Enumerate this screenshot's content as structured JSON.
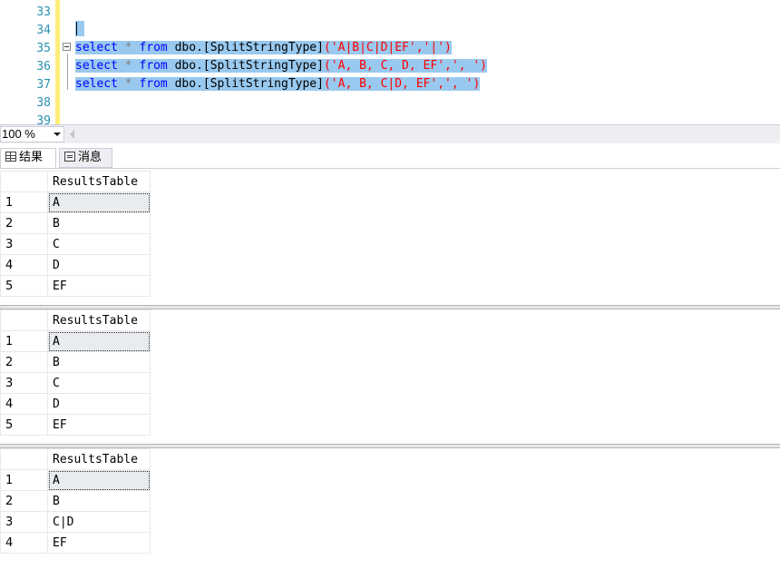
{
  "editor": {
    "line_numbers": [
      "33",
      "34",
      "35",
      "36",
      "37",
      "38",
      "39"
    ],
    "lines": [
      {
        "kw1": "select",
        "star": "*",
        "kw2": "from",
        "obj": "dbo.[SplitStringType]",
        "args": "('A|B|C|D|EF','|')"
      },
      {
        "kw1": "select",
        "star": "*",
        "kw2": "from",
        "obj": "dbo.[SplitStringType]",
        "args": "('A, B, C, D, EF',', ')"
      },
      {
        "kw1": "select",
        "star": "*",
        "kw2": "from",
        "obj": "dbo.[SplitStringType]",
        "args": "('A, B, C|D, EF',', ')"
      }
    ]
  },
  "zoom": {
    "value": "100 %"
  },
  "tabs": {
    "results": "结果",
    "messages": "消息"
  },
  "results": [
    {
      "column": "ResultsTable",
      "rows": [
        {
          "n": "1",
          "v": "A"
        },
        {
          "n": "2",
          "v": "B"
        },
        {
          "n": "3",
          "v": "C"
        },
        {
          "n": "4",
          "v": "D"
        },
        {
          "n": "5",
          "v": "EF"
        }
      ]
    },
    {
      "column": "ResultsTable",
      "rows": [
        {
          "n": "1",
          "v": "A"
        },
        {
          "n": "2",
          "v": "B"
        },
        {
          "n": "3",
          "v": "C"
        },
        {
          "n": "4",
          "v": "D"
        },
        {
          "n": "5",
          "v": "EF"
        }
      ]
    },
    {
      "column": "ResultsTable",
      "rows": [
        {
          "n": "1",
          "v": "A"
        },
        {
          "n": "2",
          "v": "B"
        },
        {
          "n": "3",
          "v": "C|D"
        },
        {
          "n": "4",
          "v": "EF"
        }
      ]
    }
  ],
  "colors": {
    "keyword": "#0000ff",
    "string": "#ff0000",
    "line_number": "#2b91af",
    "selection": "#99c9ef"
  }
}
